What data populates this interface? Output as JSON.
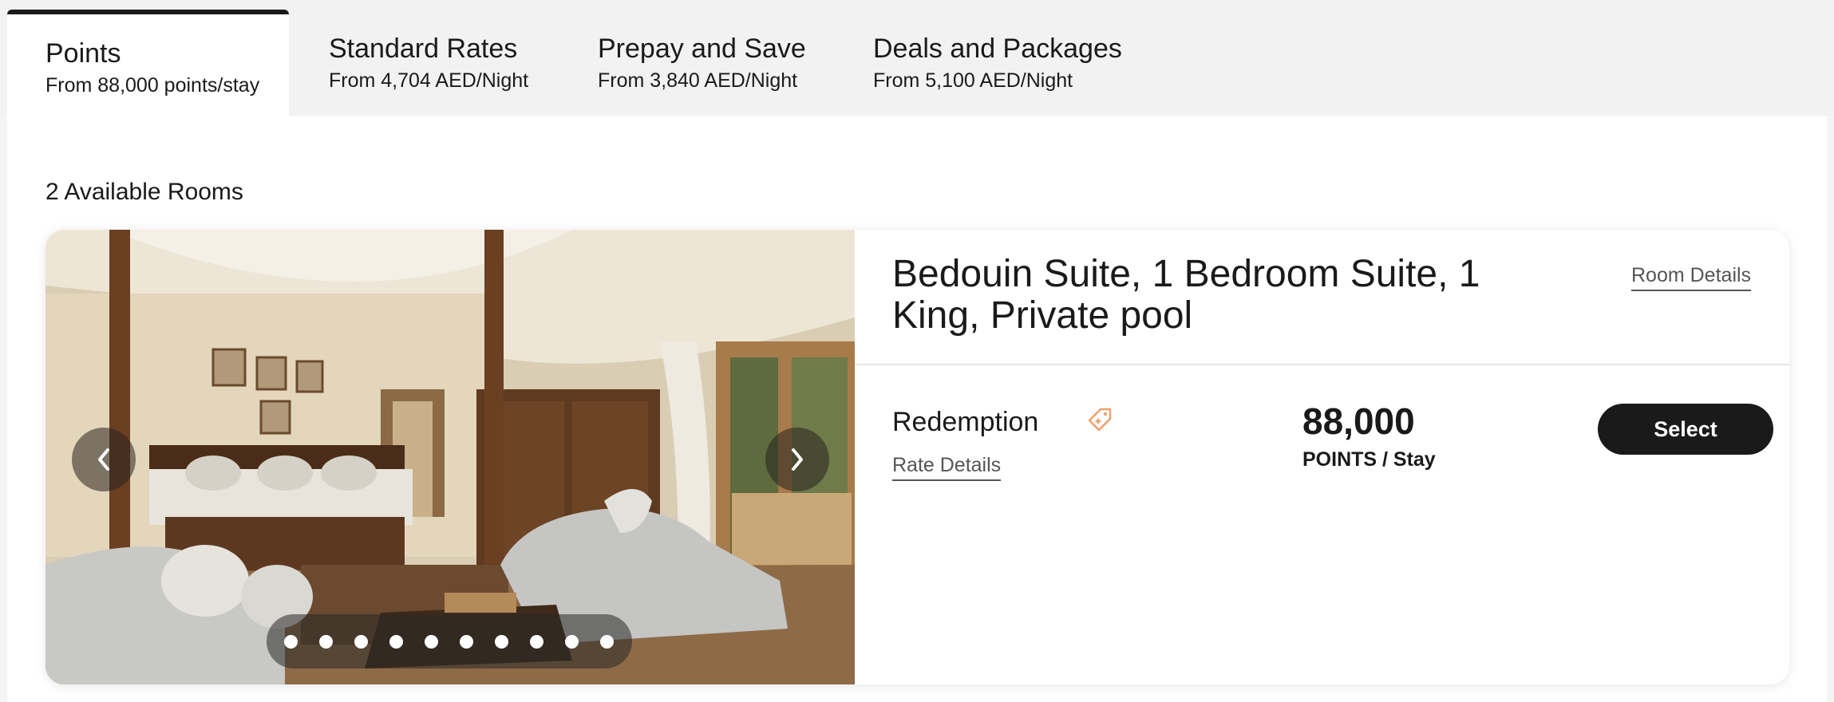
{
  "tabs": [
    {
      "title": "Points",
      "subtitle": "From 88,000 points/stay",
      "active": true
    },
    {
      "title": "Standard Rates",
      "subtitle": "From 4,704 AED/Night",
      "active": false
    },
    {
      "title": "Prepay and Save",
      "subtitle": "From 3,840 AED/Night",
      "active": false
    },
    {
      "title": "Deals and Packages",
      "subtitle": "From 5,100 AED/Night",
      "active": false
    }
  ],
  "available_rooms": "2 Available Rooms",
  "room": {
    "title": "Bedouin Suite, 1 Bedroom Suite, 1 King, Private pool",
    "details_link": "Room Details",
    "gallery": {
      "prev_icon": "chevron-left-icon",
      "next_icon": "chevron-right-icon",
      "image_count": 10,
      "active_index": 0
    },
    "rate": {
      "name": "Redemption",
      "tag_icon": "tag-icon",
      "tag_color": "#f0a06c",
      "details_link": "Rate Details",
      "price": "88,000",
      "price_unit": "POINTS / Stay",
      "select_label": "Select"
    }
  },
  "colors": {
    "accent": "#1a1a1a",
    "tabbar_bg": "#f2f2f2",
    "link": "#555555"
  }
}
